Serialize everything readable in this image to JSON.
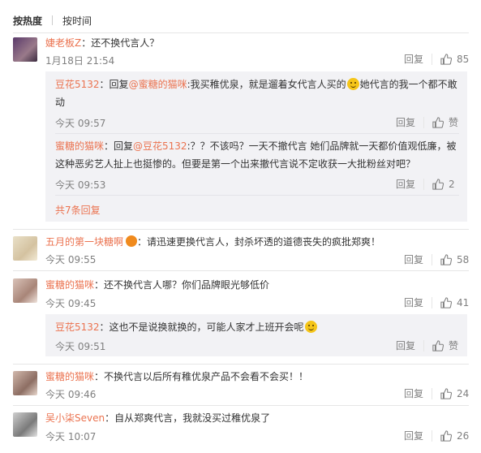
{
  "tabs": {
    "hot": "按热度",
    "time": "按时间"
  },
  "labels": {
    "reply": "回复",
    "like": "赞"
  },
  "comments": [
    {
      "user": "婕老板Z",
      "text": "：还不换代言人？",
      "time": "1月18日 21:54",
      "likes": "85",
      "replies": [
        {
          "user": "豆花5132",
          "prefix": "：回复",
          "mention": "@蜜糖的猫咪",
          "text1": ":我买稚优泉，就是遛着女代言人买的",
          "text2": "她代言的我一个都不敢",
          "text3": "动",
          "time": "今天 09:57",
          "likes": "赞"
        },
        {
          "user": "蜜糖的猫咪",
          "prefix": "：回复",
          "mention": "@豆花5132",
          "text1": ":？？不该吗？一天不撤代言 她们品牌就一天都价值观低廉，被",
          "text2": "这种恶劣艺人扯上也挺惨的。但要是第一个出来撤代言说不定收获一大批粉丝对吧？",
          "time": "今天 09:53",
          "likes": "2"
        }
      ],
      "more": "共7条回复"
    },
    {
      "user": "五月的第一块糖啊",
      "text": "：请迅速更换代言人，封杀坏透的道德丧失的疯批郑爽！",
      "time": "今天 09:55",
      "likes": "58"
    },
    {
      "user": "蜜糖的猫咪",
      "text": "：还不换代言人哪？你们品牌眼光够低价",
      "time": "今天 09:45",
      "likes": "41",
      "replies": [
        {
          "user": "豆花5132",
          "text1": "：这也不是说换就换的，可能人家才上班开会呢",
          "time": "今天 09:51",
          "likes": "赞"
        }
      ]
    },
    {
      "user": "蜜糖的猫咪",
      "text": "：不换代言以后所有稚优泉产品不会看不会买！！",
      "time": "今天 09:46",
      "likes": "24"
    },
    {
      "user": "吴小柒Seven",
      "text": "：自从郑爽代言，我就没买过稚优泉了",
      "time": "今天 10:07",
      "likes": "26"
    }
  ],
  "icons": {
    "like": "thumbs-up-icon",
    "emoji": "smiley-icon"
  }
}
